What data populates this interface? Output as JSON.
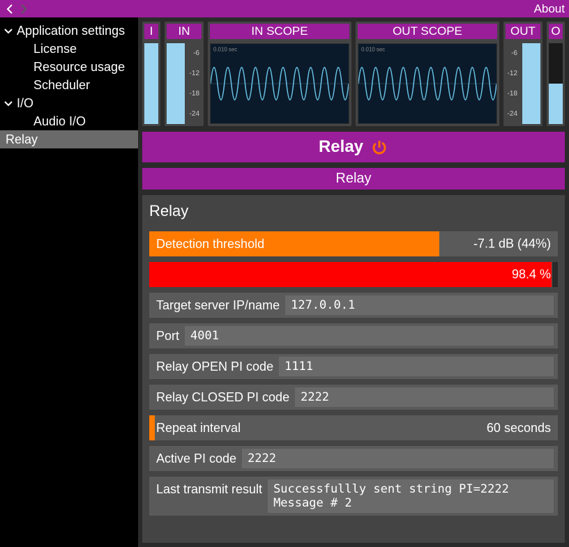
{
  "topbar": {
    "about": "About"
  },
  "sidebar": {
    "appSettings": "Application settings",
    "license": "License",
    "resourceUsage": "Resource usage",
    "scheduler": "Scheduler",
    "io": "I/O",
    "audioIO": "Audio I/O",
    "relay": "Relay"
  },
  "meters": {
    "i": "I",
    "in": "IN",
    "inScope": "IN SCOPE",
    "outScope": "OUT SCOPE",
    "out": "OUT",
    "o": "O",
    "scale": [
      "-6",
      "-12",
      "-18",
      "-24"
    ],
    "scopeTime": "0.010 sec"
  },
  "relaySection": {
    "title": "Relay",
    "subtitle": "Relay",
    "panelTitle": "Relay",
    "detectionThreshold": {
      "label": "Detection threshold",
      "value": "-7.1 dB (44%)",
      "fillPct": 71
    },
    "percentage": {
      "value": "98.4 %",
      "fillPct": 98.4
    },
    "targetServer": {
      "label": "Target server IP/name",
      "value": "127.0.0.1"
    },
    "port": {
      "label": "Port",
      "value": "4001"
    },
    "relayOpen": {
      "label": "Relay OPEN PI code",
      "value": "1111"
    },
    "relayClosed": {
      "label": "Relay CLOSED PI code",
      "value": "2222"
    },
    "repeatInterval": {
      "label": "Repeat interval",
      "value": "60 seconds"
    },
    "activePI": {
      "label": "Active PI code",
      "value": "2222"
    },
    "lastTransmit": {
      "label": "Last transmit result",
      "value": "Successfullly sent string PI=2222\nMessage # 2"
    }
  }
}
